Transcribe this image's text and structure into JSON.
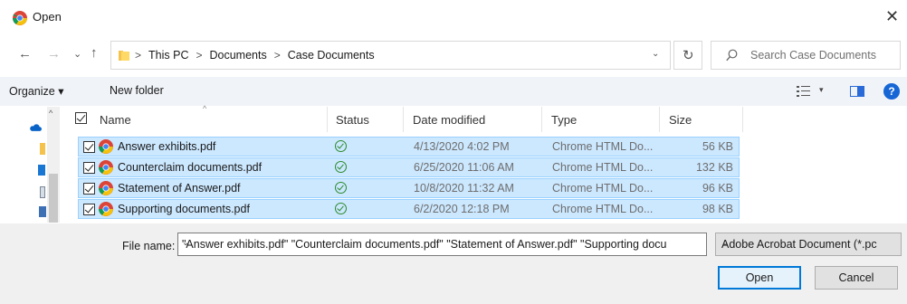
{
  "window": {
    "title": "Open",
    "close_glyph": "✕"
  },
  "nav": {
    "back_glyph": "←",
    "forward_glyph": "→",
    "recent_glyph": "⌄",
    "up_glyph": "↑"
  },
  "address": {
    "segments": [
      "This PC",
      "Documents",
      "Case Documents"
    ],
    "separator": ">",
    "dropdown_glyph": "⌄"
  },
  "refresh_glyph": "↻",
  "search": {
    "placeholder": "Search Case Documents"
  },
  "toolbar": {
    "organize_label": "Organize ▾",
    "new_folder_label": "New folder",
    "view_chevron": "▾",
    "help_label": "?"
  },
  "columns": {
    "name": "Name",
    "status": "Status",
    "date": "Date modified",
    "type": "Type",
    "size": "Size",
    "sort_glyph": "^"
  },
  "files": [
    {
      "name": "Answer exhibits.pdf",
      "date": "4/13/2020 4:02 PM",
      "type": "Chrome HTML Do...",
      "size": "56 KB"
    },
    {
      "name": "Counterclaim documents.pdf",
      "date": "6/25/2020 11:06 AM",
      "type": "Chrome HTML Do...",
      "size": "132 KB"
    },
    {
      "name": "Statement of Answer.pdf",
      "date": "10/8/2020 11:32 AM",
      "type": "Chrome HTML Do...",
      "size": "96 KB"
    },
    {
      "name": "Supporting documents.pdf",
      "date": "6/2/2020 12:18 PM",
      "type": "Chrome HTML Do...",
      "size": "98 KB"
    }
  ],
  "footer": {
    "file_name_label": "File name:",
    "file_name_value": "\"Answer exhibits.pdf\" \"Counterclaim documents.pdf\" \"Statement of Answer.pdf\" \"Supporting docu",
    "dropdown_glyph": "⌄",
    "filter_value": "Adobe Acrobat Document (*.pc",
    "open_label": "Open",
    "cancel_label": "Cancel"
  },
  "colors": {
    "selection_bg": "#cce8ff",
    "selection_border": "#99d1ff",
    "accent": "#0078d7",
    "status_ok": "#2c8a2c"
  }
}
